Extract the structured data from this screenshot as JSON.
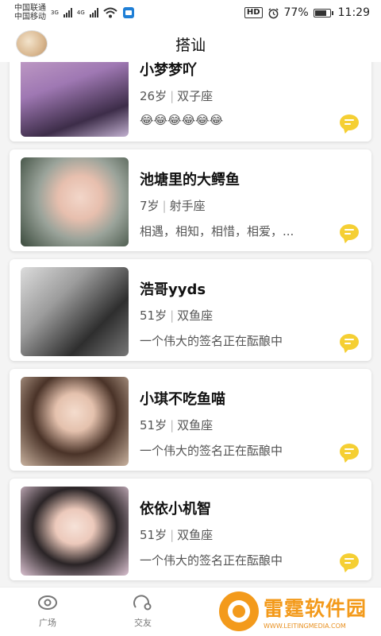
{
  "status_bar": {
    "carrier1": "中国联通",
    "carrier2": "中国移动",
    "net1": "3G",
    "net2": "4G",
    "hd": "HD",
    "battery": "77%",
    "battery_level": 0.77,
    "time": "11:29"
  },
  "header": {
    "title": "搭讪"
  },
  "users": [
    {
      "name": "小梦梦吖",
      "age": "26岁",
      "sign": "双子座",
      "signature": "😂😂😂😂😂😂"
    },
    {
      "name": "池塘里的大鳄鱼",
      "age": "7岁",
      "sign": "射手座",
      "signature": "相遇，相知，相惜，相爱，..."
    },
    {
      "name": "浩哥yyds",
      "age": "51岁",
      "sign": "双鱼座",
      "signature": "一个伟大的签名正在酝酿中"
    },
    {
      "name": "小琪不吃鱼喵",
      "age": "51岁",
      "sign": "双鱼座",
      "signature": "一个伟大的签名正在酝酿中"
    },
    {
      "name": "依依小机智",
      "age": "51岁",
      "sign": "双鱼座",
      "signature": "一个伟大的签名正在酝酿中"
    }
  ],
  "tabs": [
    {
      "label": "广场"
    },
    {
      "label": "交友"
    }
  ],
  "watermark": {
    "cn": "雷霆软件园",
    "en": "WWW.LEITINGMEDIA.COM"
  },
  "colors": {
    "accent": "#f5cf33",
    "watermark": "#f39a1b"
  }
}
